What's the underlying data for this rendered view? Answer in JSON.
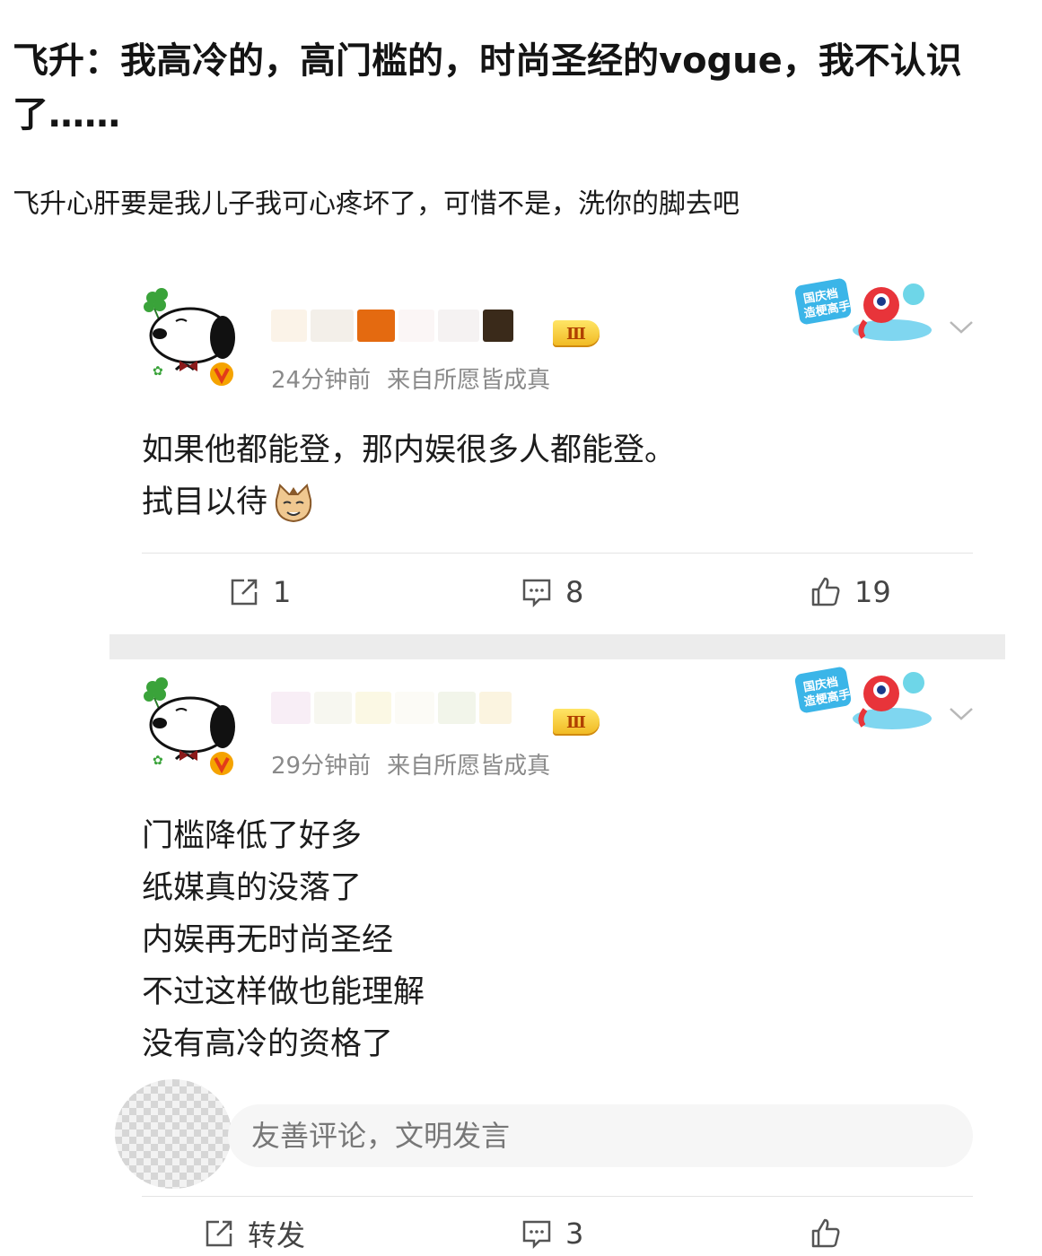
{
  "post": {
    "headline": "飞升：我高冷的，高门槛的，时尚圣经的vogue，我不认识了……",
    "subline": "飞升心肝要是我儿子我可心疼坏了，可惜不是，洗你的脚去吧"
  },
  "comments": [
    {
      "level_badge": "Ⅲ",
      "time": "24分钟前",
      "source": "来自所愿皆成真",
      "lines": [
        "如果他都能登，那内娱很多人都能登。",
        "拭目以待"
      ],
      "emoji_icon": "cat-face-icon",
      "repost_count": "1",
      "comment_count": "8",
      "like_count": "19"
    },
    {
      "level_badge": "Ⅲ",
      "time": "29分钟前",
      "source": "来自所愿皆成真",
      "lines": [
        "门槛降低了好多",
        "纸媒真的没落了",
        "内娱再无时尚圣经",
        "不过这样做也能理解",
        "没有高冷的资格了"
      ],
      "comment_placeholder": "友善评论，文明发言",
      "repost_label": "转发",
      "comment_count": "3"
    }
  ],
  "icons": {
    "avatar": "snoopy-avatar-icon",
    "verified": "verified-v-icon",
    "event_badge": "national-day-badge-icon",
    "more": "chevron-down-icon",
    "repost": "repost-icon",
    "comment": "comment-icon",
    "like": "thumbs-up-icon"
  },
  "colors": {
    "verified": "#f5a300",
    "level_badge": "#f7c93a",
    "meta_text": "#8a8a8a",
    "divider": "#ececec"
  }
}
